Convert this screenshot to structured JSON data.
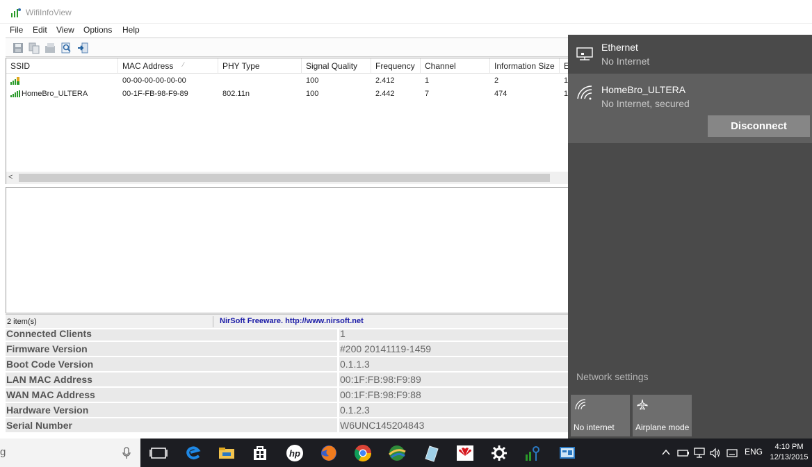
{
  "window": {
    "title": "WifiInfoView"
  },
  "menu": [
    "File",
    "Edit",
    "View",
    "Options",
    "Help"
  ],
  "columns": [
    "SSID",
    "MAC Address",
    "PHY Type",
    "Signal Quality",
    "Frequency",
    "Channel",
    "Information Size",
    "E"
  ],
  "rows": [
    {
      "ssid": "",
      "mac": "00-00-00-00-00-00",
      "phy": "",
      "signal": "100",
      "freq": "2.412",
      "channel": "1",
      "info": "2",
      "e": "1"
    },
    {
      "ssid": "HomeBro_ULTERA",
      "mac": "00-1F-FB-98-F9-89",
      "phy": "802.11n",
      "signal": "100",
      "freq": "2.442",
      "channel": "7",
      "info": "474",
      "e": "1"
    }
  ],
  "status": {
    "count": "2 item(s)",
    "link": "NirSoft Freeware.  http://www.nirsoft.net"
  },
  "router": [
    {
      "label": "Connected Clients",
      "value": "1"
    },
    {
      "label": "Firmware Version",
      "value": "#200 20141119-1459"
    },
    {
      "label": "Boot Code Version",
      "value": "0.1.1.3"
    },
    {
      "label": "LAN MAC Address",
      "value": "00:1F:FB:98:F9:89"
    },
    {
      "label": "WAN MAC Address",
      "value": "00:1F:FB:98:F9:88"
    },
    {
      "label": "Hardware Version",
      "value": "0.1.2.3"
    },
    {
      "label": "Serial Number",
      "value": "W6UNC145204843"
    }
  ],
  "flyout": {
    "ethernet": {
      "name": "Ethernet",
      "status": "No Internet"
    },
    "wifi": {
      "name": "HomeBro_ULTERA",
      "status": "No Internet, secured",
      "disconnect": "Disconnect"
    },
    "settings": "Network settings",
    "tiles": [
      "No internet",
      "Airplane mode"
    ]
  },
  "taskbar": {
    "search_glyph": "g",
    "lang": "ENG",
    "time": "4:10 PM",
    "date": "12/13/2015"
  },
  "colors": {
    "flyout": "#4a4a4a",
    "wifi_selected": "#5f5f5f",
    "taskbar": "#1c1d22",
    "link": "#1a1aa6"
  }
}
